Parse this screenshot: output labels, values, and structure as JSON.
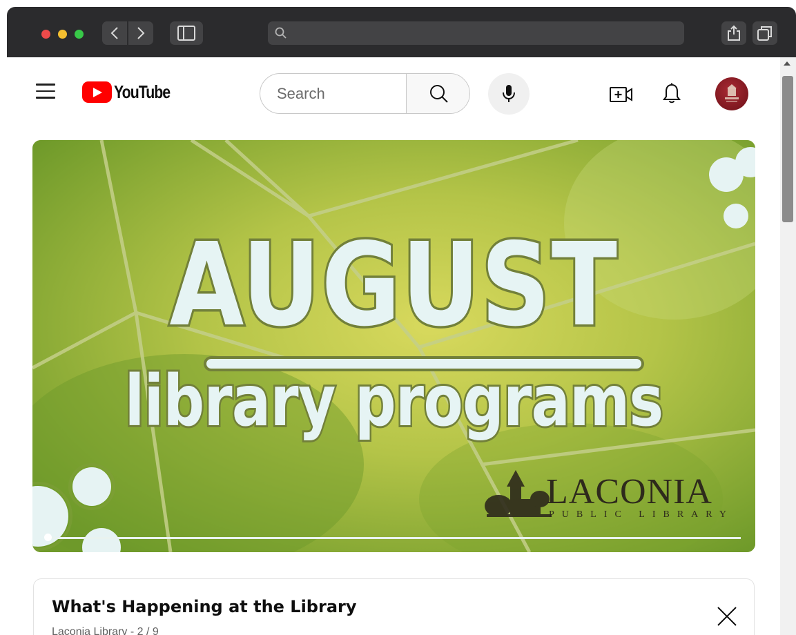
{
  "browser": {
    "traffic_lights": [
      "red",
      "yellow",
      "green"
    ],
    "toolbar_icons": [
      "back-icon",
      "forward-icon",
      "sidebar-icon",
      "share-icon",
      "tabs-icon"
    ],
    "address_bar_icon": "search-icon"
  },
  "header": {
    "logo_text": "YouTube",
    "search_placeholder": "Search",
    "icons": [
      "menu-icon",
      "search-icon",
      "microphone-icon",
      "create-video-icon",
      "bell-icon"
    ],
    "avatar_icon": "channel-avatar"
  },
  "video": {
    "title_line1": "AUGUST",
    "title_line2": "library programs",
    "library_name": "LACONIA",
    "library_subtitle": "PUBLIC LIBRARY",
    "progress_fraction": 0.01
  },
  "playlist": {
    "title": "What's Happening at the Library",
    "meta": "Laconia Library - 2 / 9"
  },
  "colors": {
    "accent": "#ff0000",
    "leaf_green": "#9db43d",
    "avatar": "#8b1a22"
  }
}
